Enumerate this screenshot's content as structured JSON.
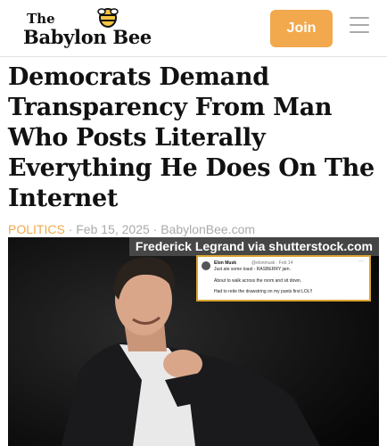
{
  "header": {
    "logo_the": "The",
    "logo_word": "Babylon Bee",
    "join_label": "Join"
  },
  "article": {
    "headline": "Democrats Demand Transparency From Man Who Posts Literally Everything He Does On The Internet",
    "category": "POLITICS",
    "date": "Feb 15, 2025",
    "source": "BabylonBee.com",
    "separator": "·"
  },
  "image": {
    "credit": "Frederick Legrand via shutterstock.com",
    "tweet": {
      "name": "Elon Musk",
      "handle": "@elonmusk · Feb 14",
      "line1": "Just ate some toast - RASBERRY jam.",
      "line2": "About to walk across the room and sit down.",
      "line3": "Had to retie the drawstring on my pants first LOL!!",
      "more": "···"
    }
  },
  "colors": {
    "accent": "#f2a94e",
    "text": "#111111",
    "meta": "#aaaaaa"
  },
  "icons": [
    "bee-icon",
    "hamburger-menu-icon",
    "verified-icon"
  ]
}
